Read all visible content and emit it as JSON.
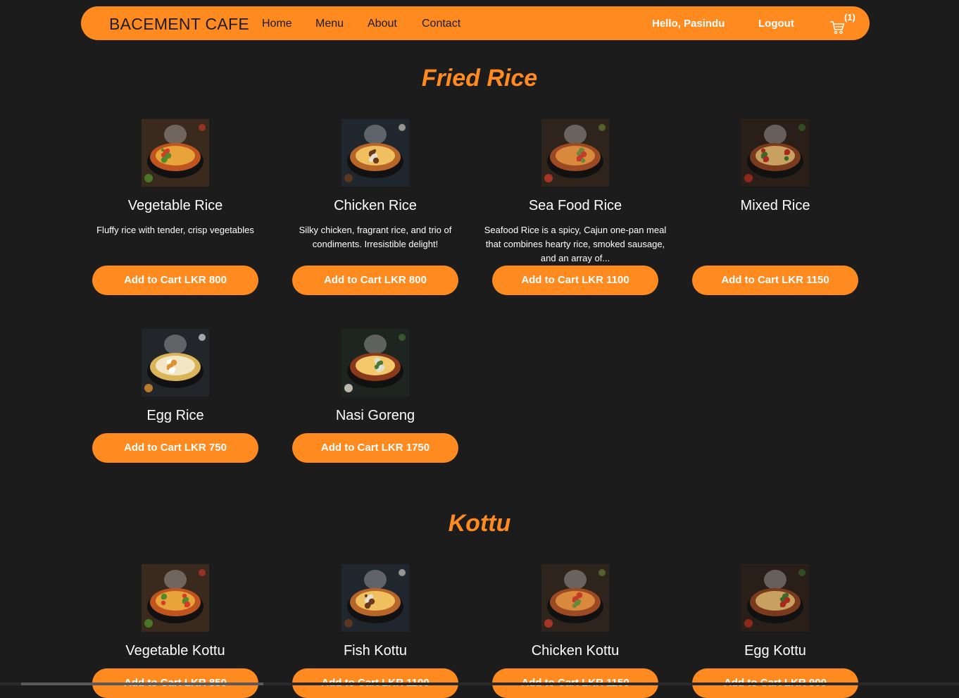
{
  "nav": {
    "brand": "BACEMENT CAFE",
    "links": [
      "Home",
      "Menu",
      "About",
      "Contact"
    ],
    "greeting": "Hello, Pasindu",
    "logout": "Logout",
    "cart_count": "(1)",
    "cart_icon": "shopping-cart-icon"
  },
  "colors": {
    "accent": "#ff8a1f",
    "background": "#1c1c1c",
    "text": "#ffffff"
  },
  "sections": [
    {
      "title": "Fried Rice",
      "items": [
        {
          "name": "Vegetable Rice",
          "desc": "Fluffy rice with tender, crisp vegetables",
          "button": "Add to Cart LKR 800"
        },
        {
          "name": "Chicken Rice",
          "desc": "Silky chicken, fragrant rice, and trio of condiments. Irresistible delight!",
          "button": "Add to Cart LKR 800"
        },
        {
          "name": "Sea Food Rice",
          "desc": "Seafood Rice is a spicy, Cajun one-pan meal that combines hearty rice, smoked sausage, and an array of...",
          "button": "Add to Cart LKR 1100"
        },
        {
          "name": "Mixed Rice",
          "desc": "",
          "button": "Add to Cart LKR 1150"
        },
        {
          "name": "Egg Rice",
          "desc": "",
          "button": "Add to Cart LKR 750"
        },
        {
          "name": "Nasi Goreng",
          "desc": "",
          "button": "Add to Cart LKR 1750"
        }
      ]
    },
    {
      "title": "Kottu",
      "items": [
        {
          "name": "Vegetable Kottu",
          "desc": "",
          "button": "Add to Cart LKR 850"
        },
        {
          "name": "Fish Kottu",
          "desc": "",
          "button": "Add to Cart LKR 1100"
        },
        {
          "name": "Chicken Kottu",
          "desc": "",
          "button": "Add to Cart LKR 1150"
        },
        {
          "name": "Egg Kottu",
          "desc": "",
          "button": "Add to Cart LKR 900"
        }
      ]
    }
  ]
}
